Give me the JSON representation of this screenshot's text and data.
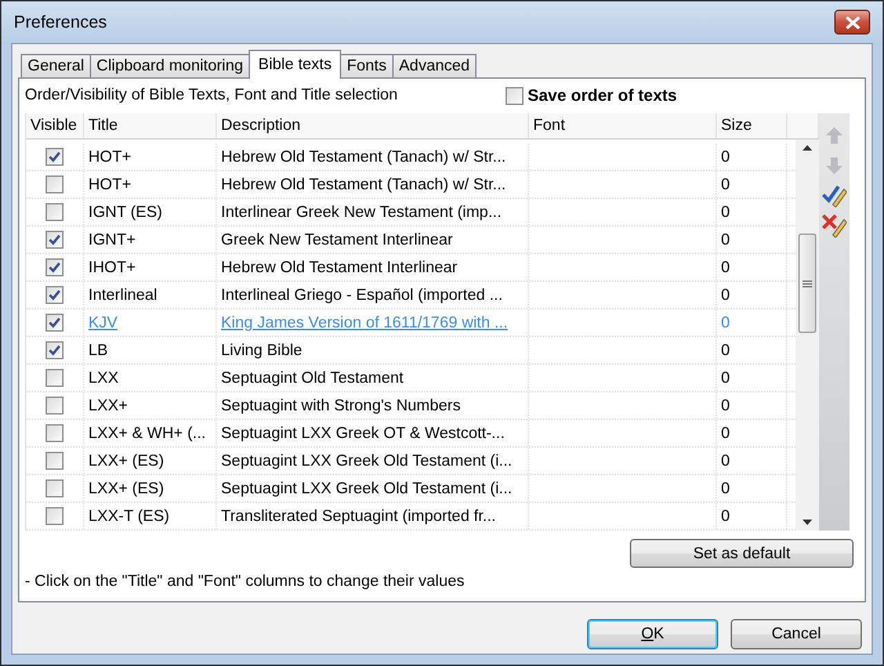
{
  "window": {
    "title": "Preferences"
  },
  "tabs": [
    {
      "label": "General",
      "selected": false
    },
    {
      "label": "Clipboard monitoring",
      "selected": false
    },
    {
      "label": "Bible texts",
      "selected": true
    },
    {
      "label": "Fonts",
      "selected": false
    },
    {
      "label": "Advanced",
      "selected": false
    }
  ],
  "panel": {
    "heading": "Order/Visibility of Bible Texts, Font and Title selection",
    "save_order": {
      "label": "Save order of texts",
      "checked": false
    }
  },
  "table": {
    "columns": [
      "Visible",
      "Title",
      "Description",
      "Font",
      "Size"
    ],
    "rows": [
      {
        "visible": true,
        "title": "HOT+",
        "description": "Hebrew Old Testament (Tanach) w/ Str...",
        "size": "0",
        "selected": false
      },
      {
        "visible": false,
        "title": "HOT+",
        "description": "Hebrew Old Testament (Tanach) w/ Str...",
        "size": "0",
        "selected": false
      },
      {
        "visible": false,
        "title": "IGNT (ES)",
        "description": "Interlinear Greek New Testament (imp...",
        "size": "0",
        "selected": false
      },
      {
        "visible": true,
        "title": "IGNT+",
        "description": "Greek New Testament Interlinear",
        "size": "0",
        "selected": false
      },
      {
        "visible": true,
        "title": "IHOT+",
        "description": "Hebrew Old Testament Interlinear",
        "size": "0",
        "selected": false
      },
      {
        "visible": true,
        "title": "Interlineal",
        "description": "Interlineal Griego - Español (imported ...",
        "size": "0",
        "selected": false
      },
      {
        "visible": true,
        "title": "KJV",
        "description": "King James Version of 1611/1769 with ...",
        "size": "0",
        "selected": true
      },
      {
        "visible": true,
        "title": "LB",
        "description": "Living Bible",
        "size": "0",
        "selected": false
      },
      {
        "visible": false,
        "title": "LXX",
        "description": "Septuagint Old Testament",
        "size": "0",
        "selected": false
      },
      {
        "visible": false,
        "title": "LXX+",
        "description": "Septuagint with Strong's Numbers",
        "size": "0",
        "selected": false
      },
      {
        "visible": false,
        "title": "LXX+ & WH+ (...",
        "description": "Septuagint LXX Greek OT & Westcott-...",
        "size": "0",
        "selected": false
      },
      {
        "visible": false,
        "title": "LXX+ (ES)",
        "description": "Septuagint LXX Greek Old Testament (i...",
        "size": "0",
        "selected": false
      },
      {
        "visible": false,
        "title": "LXX+ (ES)",
        "description": "Septuagint LXX Greek Old Testament (i...",
        "size": "0",
        "selected": false
      },
      {
        "visible": false,
        "title": "LXX-T (ES)",
        "description": "Transliterated Septuagint (imported fr...",
        "size": "0",
        "selected": false
      }
    ]
  },
  "toolbar": [
    {
      "kind": "up",
      "disabled": true
    },
    {
      "kind": "down",
      "disabled": true
    },
    {
      "kind": "check",
      "disabled": false
    },
    {
      "kind": "clear",
      "disabled": false
    }
  ],
  "set_default": "Set as default",
  "hint": "- Click on the \"Title\" and \"Font\" columns to change their values",
  "buttons": [
    {
      "label": "OK",
      "default": true
    },
    {
      "label": "Cancel",
      "default": false
    }
  ]
}
